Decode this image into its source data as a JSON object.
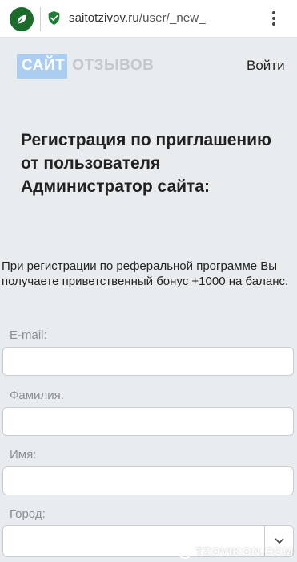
{
  "browser": {
    "url_host": "saitotzivov.ru",
    "url_path": "/user/_new_",
    "site_icon": "leaf-icon",
    "secure_icon": "shield-check-icon",
    "menu_icon": "kebab-menu-icon"
  },
  "header": {
    "logo_part1": "САЙТ",
    "logo_part2": "ОТЗЫВОВ",
    "login_label": "Войти"
  },
  "main": {
    "title": "Регистрация по приглашению от пользователя Администратор сайта:",
    "promo_text": "При регистрации по реферальной программе Вы получаете приветственный бонус +1000 на баланс."
  },
  "form": {
    "email_label": "E-mail:",
    "email_value": "",
    "lastname_label": "Фамилия:",
    "lastname_value": "",
    "firstname_label": "Имя:",
    "firstname_value": "",
    "city_label": "Город:",
    "city_value": ""
  },
  "watermark": {
    "text": "TZOVIKON.COM"
  },
  "colors": {
    "page_bg": "#e9ecef",
    "logo_accent": "#aacdf0",
    "site_icon_bg": "#1b6b2a",
    "secure_green": "#1e7e34"
  }
}
